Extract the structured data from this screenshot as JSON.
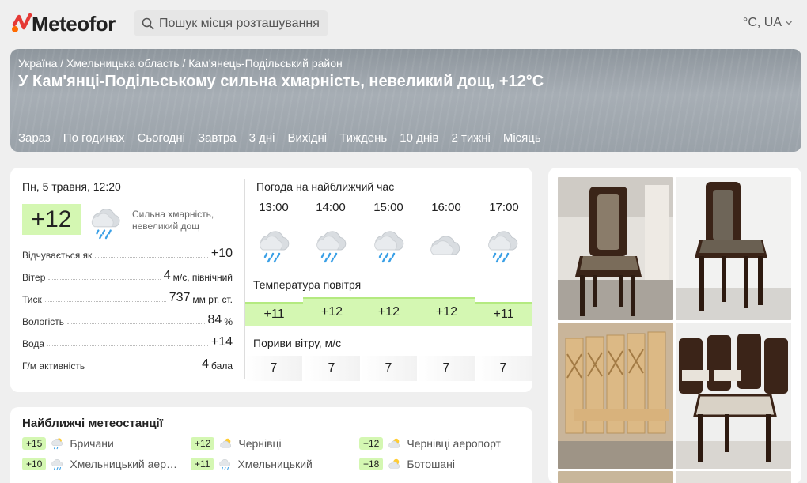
{
  "brand": {
    "name": "Meteofor"
  },
  "search": {
    "placeholder": "Пошук місця розташування"
  },
  "units": {
    "label": "°C, UA"
  },
  "breadcrumb": [
    "Україна",
    "Хмельницька область",
    "Кам'янець-Подільський район"
  ],
  "breadcrumb_sep": " / ",
  "hero": {
    "title": "У Кам'янці-Подільському сильна хмарність, невеликий дощ, +12°C"
  },
  "tabs": [
    "Зараз",
    "По годинах",
    "Сьогодні",
    "Завтра",
    "3 дні",
    "Вихідні",
    "Тиждень",
    "10 днів",
    "2 тижні",
    "Місяць"
  ],
  "now": {
    "date": "Пн, 5 травня, 12:20",
    "temp": "+12",
    "icon": "cloud-rain-icon",
    "description_line1": "Сильна хмарність,",
    "description_line2": "невеликий дощ",
    "params": [
      {
        "label": "Відчувається як",
        "value": "+10",
        "unit": ""
      },
      {
        "label": "Вітер",
        "value": "4",
        "unit": "м/с, північний"
      },
      {
        "label": "Тиск",
        "value": "737",
        "unit": "мм рт. ст."
      },
      {
        "label": "Вологість",
        "value": "84",
        "unit": "%"
      },
      {
        "label": "Вода",
        "value": "+14",
        "unit": ""
      },
      {
        "label": "Г/м активність",
        "value": "4",
        "unit": "бала"
      }
    ]
  },
  "hourly": {
    "title": "Погода на найближчий час",
    "hours": [
      "13:00",
      "14:00",
      "15:00",
      "16:00",
      "17:00"
    ],
    "icons": [
      "cloud-rain-icon",
      "cloud-rain-icon",
      "cloud-rain-icon",
      "cloud-icon",
      "cloud-rain-icon"
    ],
    "temp_title": "Температура повітря",
    "temps": [
      "+11",
      "+12",
      "+12",
      "+12",
      "+11"
    ],
    "gust_title": "Пориви вітру, м/с",
    "gusts": [
      "7",
      "7",
      "7",
      "7",
      "7"
    ]
  },
  "stations": {
    "title": "Найближчі метеостанції",
    "items": [
      {
        "temp": "+15",
        "name": "Бричани",
        "icon": "partly-cloudy-rain-icon"
      },
      {
        "temp": "+12",
        "name": "Чернівці",
        "icon": "partly-cloudy-icon"
      },
      {
        "temp": "+12",
        "name": "Чернівці аеропорт",
        "icon": "partly-cloudy-icon"
      },
      {
        "temp": "+10",
        "name": "Хмельницький аер…",
        "icon": "cloud-rain-icon"
      },
      {
        "temp": "+11",
        "name": "Хмельницький",
        "icon": "cloud-rain-icon"
      },
      {
        "temp": "+18",
        "name": "Ботошані",
        "icon": "partly-cloudy-icon"
      }
    ]
  },
  "ad": {
    "info_icon": "info-icon",
    "more_icon": "more-vertical-icon",
    "images": [
      "chair-photo",
      "chair-photo",
      "chairs-group-photo",
      "chairs-group-photo"
    ]
  },
  "colors": {
    "brand_orange": "#ff6a00",
    "brand_red": "#e53935",
    "temp_green": "#d4f7b2",
    "hero_gray": "#a3aab1"
  }
}
